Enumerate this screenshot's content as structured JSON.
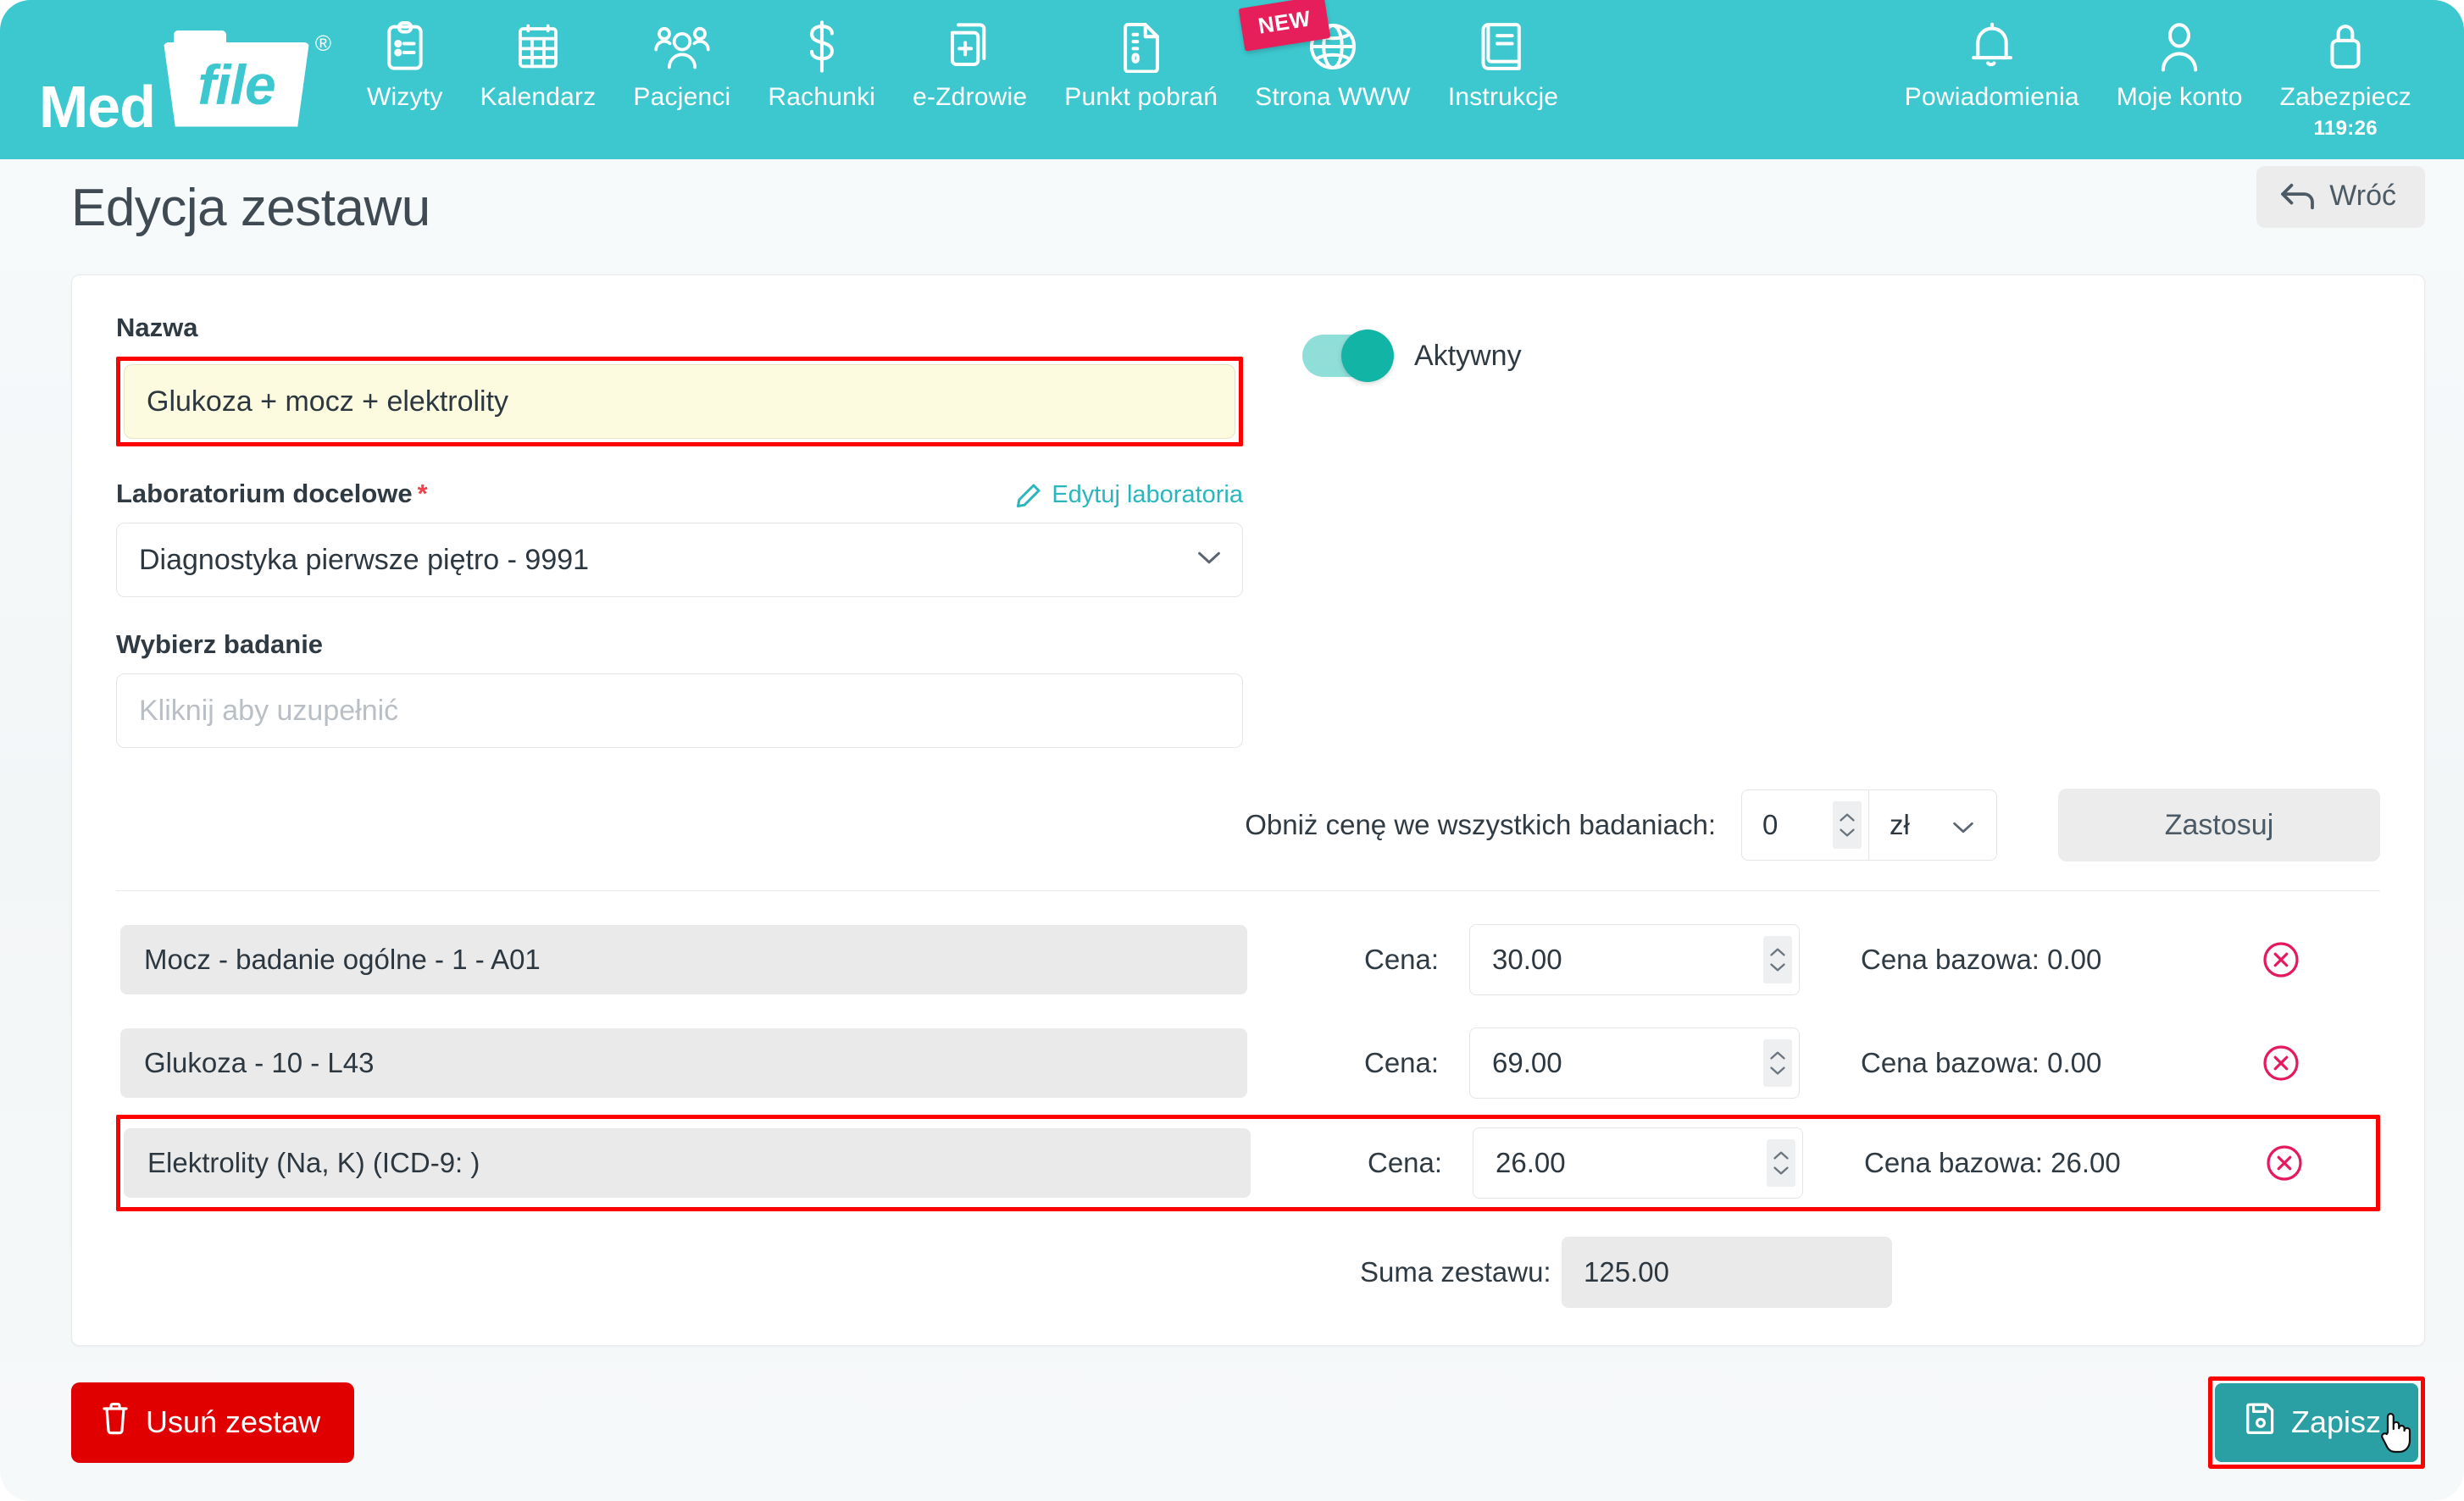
{
  "navbar": {
    "brand": {
      "med": "Med",
      "file": "file",
      "reg": "®"
    },
    "items": [
      {
        "label": "Wizyty",
        "icon": "clipboard-icon"
      },
      {
        "label": "Kalendarz",
        "icon": "calendar-icon"
      },
      {
        "label": "Pacjenci",
        "icon": "people-icon"
      },
      {
        "label": "Rachunki",
        "icon": "dollar-icon"
      },
      {
        "label": "e-Zdrowie",
        "icon": "medical-record-icon"
      },
      {
        "label": "Punkt pobrań",
        "icon": "document-icon"
      },
      {
        "label": "Strona WWW",
        "icon": "globe-icon",
        "badge": "NEW"
      },
      {
        "label": "Instrukcje",
        "icon": "book-icon"
      }
    ],
    "right_items": [
      {
        "label": "Powiadomienia",
        "icon": "bell-icon"
      },
      {
        "label": "Moje konto",
        "icon": "user-icon"
      },
      {
        "label": "Zabezpiecz",
        "icon": "lock-icon",
        "sub": "119:26"
      }
    ]
  },
  "header": {
    "title": "Edycja zestawu",
    "back_label": "Wróć"
  },
  "form": {
    "name_label": "Nazwa",
    "name_value": "Glukoza + mocz + elektrolity",
    "active_label": "Aktywny",
    "active_on": true,
    "lab_label": "Laboratorium docelowe",
    "lab_required": "*",
    "edit_labs_label": "Edytuj laboratoria",
    "lab_value": "Diagnostyka pierwsze piętro - 9991",
    "choose_test_label": "Wybierz badanie",
    "choose_test_placeholder": "Kliknij aby uzupełnić",
    "choose_test_value": ""
  },
  "discount": {
    "label": "Obniż cenę we wszystkich badaniach:",
    "value": "0",
    "unit": "zł",
    "apply_label": "Zastosuj"
  },
  "table": {
    "price_label": "Cena:",
    "rows": [
      {
        "name": "Mocz - badanie ogólne - 1 - A01",
        "price": "30.00",
        "base_price": "Cena bazowa: 0.00",
        "highlighted": false
      },
      {
        "name": "Glukoza - 10 - L43",
        "price": "69.00",
        "base_price": "Cena bazowa: 0.00",
        "highlighted": false
      },
      {
        "name": "Elektrolity (Na, K) (ICD-9: )",
        "price": "26.00",
        "base_price": "Cena bazowa: 26.00",
        "highlighted": true
      }
    ],
    "sum_label": "Suma zestawu:",
    "sum_value": "125.00"
  },
  "footer": {
    "delete_label": "Usuń zestaw",
    "save_label": "Zapisz"
  },
  "colors": {
    "brand_teal": "#3dc8cf",
    "toggle_on": "#12b5a5",
    "accent_link": "#2bb6bd",
    "danger": "#e00000",
    "save": "#2a9fa4",
    "highlight": "#ff0000",
    "badge_pink": "#e61e5a"
  }
}
